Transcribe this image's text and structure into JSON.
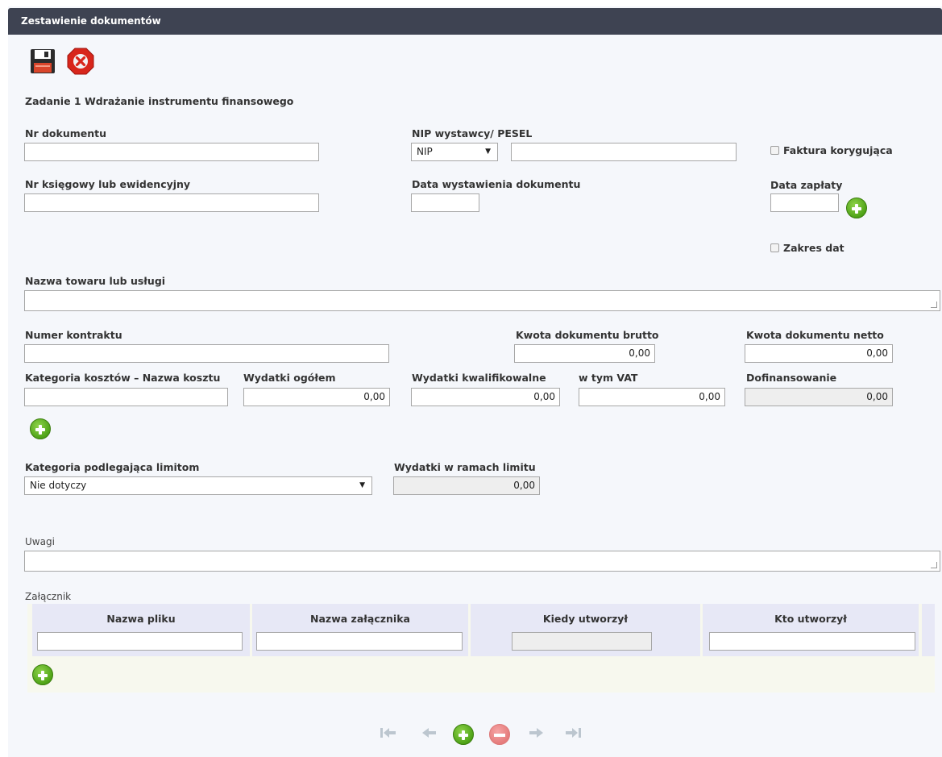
{
  "title": "Zestawienie dokumentów",
  "toolbar": {
    "save_icon": "floppy-disk-icon",
    "cancel_icon": "red-x-icon"
  },
  "task_label": "Zadanie 1 Wdrażanie instrumentu finansowego",
  "labels": {
    "nr_dokumentu": "Nr dokumentu",
    "nip_pesel": "NIP wystawcy/ PESEL",
    "faktura_korygujaca": "Faktura korygująca",
    "nr_ksiegowy": "Nr księgowy lub ewidencyjny",
    "data_wystawienia": "Data wystawienia dokumentu",
    "data_zaplaty": "Data zapłaty",
    "zakres_dat": "Zakres dat",
    "nazwa_towaru": "Nazwa towaru lub usługi",
    "numer_kontraktu": "Numer kontraktu",
    "kwota_brutto": "Kwota dokumentu brutto",
    "kwota_netto": "Kwota dokumentu netto",
    "kategoria_kosztow": "Kategoria kosztów – Nazwa kosztu",
    "wydatki_ogolem": "Wydatki ogółem",
    "wydatki_kwalifikowalne": "Wydatki kwalifikowalne",
    "w_tym_vat": "w tym VAT",
    "dofinansowanie": "Dofinansowanie",
    "kategoria_limit": "Kategoria podlegająca limitom",
    "wydatki_limit": "Wydatki w ramach limitu",
    "uwagi": "Uwagi",
    "zalacznik": "Załącznik"
  },
  "values": {
    "nip_type": "NIP",
    "kwota_brutto": "0,00",
    "kwota_netto": "0,00",
    "wydatki_ogolem": "0,00",
    "wydatki_kwalifikowalne": "0,00",
    "w_tym_vat": "0,00",
    "dofinansowanie": "0,00",
    "kategoria_limit": "Nie dotyczy",
    "wydatki_limit": "0,00"
  },
  "attachments": {
    "columns": [
      "Nazwa pliku",
      "Nazwa załącznika",
      "Kiedy utworzył",
      "Kto utworzył"
    ]
  },
  "colors": {
    "titlebar": "#3e4352",
    "add_green": "#4fa317",
    "remove_red": "#e57c7c"
  }
}
